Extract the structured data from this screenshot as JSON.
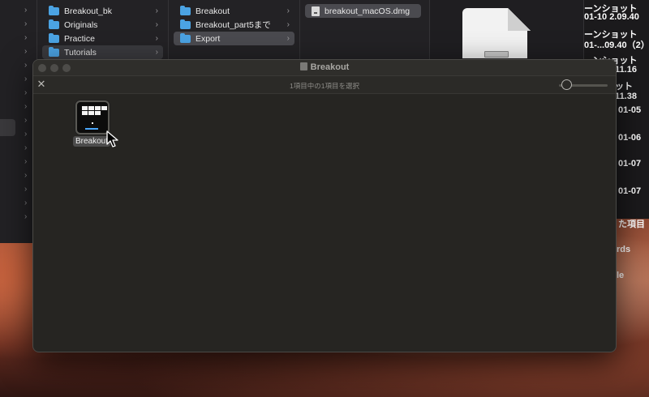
{
  "finder": {
    "column1": [
      {
        "label": "Breakout_bk",
        "selected": false
      },
      {
        "label": "Originals",
        "selected": false
      },
      {
        "label": "Practice",
        "selected": false
      },
      {
        "label": "Tutorials",
        "selected": true
      }
    ],
    "column2": [
      {
        "label": "Breakout",
        "selected": false
      },
      {
        "label": "Breakout_part5まで",
        "selected": false
      },
      {
        "label": "Export",
        "selected": true
      }
    ],
    "column3": [
      {
        "label": "breakout_macOS.dmg",
        "selected": true
      }
    ],
    "chevron": "›"
  },
  "desktop_labels": [
    "ーンショット",
    "01-10 2.09.40",
    "ーンショット",
    "01-...09.40（2）",
    "ーンショット",
    ".11.16",
    "ット",
    ".11.38",
    "01-05",
    "01-06",
    "01-07",
    "01-07",
    "た項目",
    "rds",
    "le"
  ],
  "quicklook": {
    "title": "Breakout",
    "status": "1項目中の1項目を選択",
    "close_glyph": "✕",
    "item_label": "Breakout",
    "zoom_level": 0.1
  },
  "colors": {
    "folder": "#4ba3e3",
    "paddle": "#4aa8ff",
    "window_bg": "#262522"
  },
  "icons": [
    "folder-icon",
    "dmg-file-icon",
    "close-icon",
    "zoom-slider",
    "app-icon",
    "pointer-cursor-icon"
  ]
}
